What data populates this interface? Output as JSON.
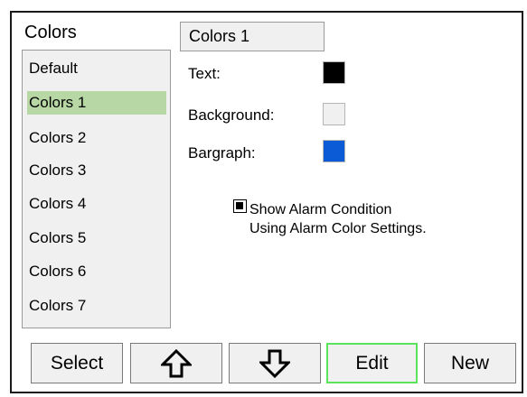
{
  "panel": {
    "title": "Colors"
  },
  "list": {
    "items": [
      {
        "label": "Default"
      },
      {
        "label": "Colors 1"
      },
      {
        "label": "Colors 2"
      },
      {
        "label": "Colors 3"
      },
      {
        "label": "Colors 4"
      },
      {
        "label": "Colors 5"
      },
      {
        "label": "Colors 6"
      },
      {
        "label": "Colors 7"
      }
    ],
    "selected_index": 1,
    "selected_color": "#b7d8a5"
  },
  "scheme": {
    "name": "Colors 1"
  },
  "fields": {
    "text": {
      "label": "Text:",
      "color": "#000000"
    },
    "background": {
      "label": "Background:",
      "color": "#f0f0f0"
    },
    "bargraph": {
      "label": "Bargraph:",
      "color": "#0b5bd6"
    }
  },
  "alarm": {
    "checked": true,
    "line1": "Show Alarm Condition",
    "line2": "Using Alarm Color Settings."
  },
  "buttons": {
    "select": "Select",
    "up": "up-arrow-icon",
    "down": "down-arrow-icon",
    "edit": "Edit",
    "new": "New"
  },
  "colors": {
    "focus_border": "#5be35b",
    "panel_bg": "#f0f0f0"
  }
}
